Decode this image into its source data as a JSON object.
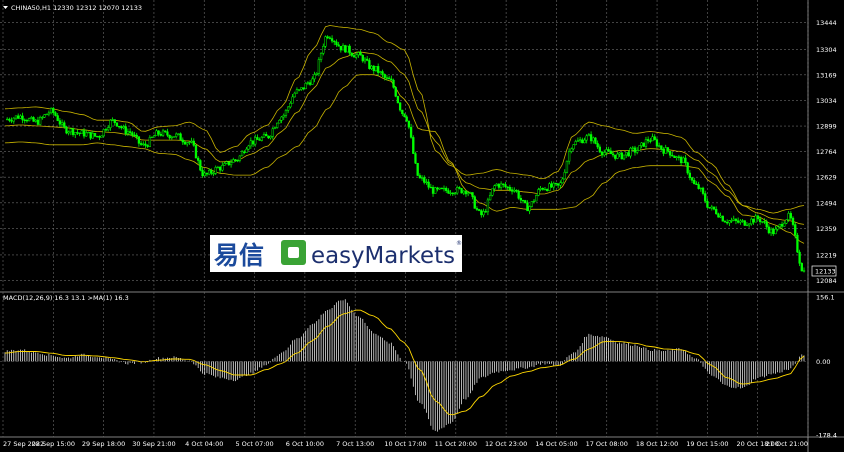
{
  "colors": {
    "background": "#000000",
    "candle": "#00ff00",
    "band": "#c8b400",
    "grid": "#6b6b6b",
    "histogram": "#ffffff",
    "signal": "#ffd800",
    "text": "#ffffff",
    "logo_cn": "#1b4a9c",
    "logo_green": "#3aa335",
    "logo_text": "#1c2f6e"
  },
  "header": {
    "symbol_line": "CHINA50,H1  12330 12312 12070 12133",
    "arrow_icon": "triangle-down-icon"
  },
  "price_last_label": "12133",
  "logo": {
    "chinese": "易信",
    "brand": "easyMarkets",
    "registered": "®"
  },
  "macd_header": "MACD(12,26,9) 16.3 13.1  >MA(1) 16.3",
  "chart_data": [
    {
      "type": "candlestick",
      "title": "CHINA50,H1",
      "indicator": "Bollinger Bands",
      "y_ticks": [
        "13444",
        "13304",
        "13169",
        "13034",
        "12899",
        "12764",
        "12629",
        "12494",
        "12359",
        "12219",
        "12084"
      ],
      "ylim": [
        12050,
        13490
      ],
      "last": 12133,
      "series": [
        {
          "name": "close",
          "values": [
            12935,
            12950,
            12920,
            12975,
            12880,
            12860,
            12845,
            12925,
            12870,
            12795,
            12860,
            12850,
            12815,
            12640,
            12680,
            12720,
            12815,
            12840,
            12950,
            13080,
            13140,
            13380,
            13310,
            13270,
            13200,
            13140,
            12960,
            12620,
            12555,
            12560,
            12560,
            12430,
            12590,
            12570,
            12470,
            12575,
            12580,
            12810,
            12840,
            12760,
            12740,
            12770,
            12830,
            12770,
            12720,
            12580,
            12460,
            12400,
            12390,
            12410,
            12340,
            12420,
            12133
          ]
        },
        {
          "name": "upper",
          "values": [
            12990,
            12995,
            13000,
            12990,
            12975,
            12960,
            12930,
            12930,
            12920,
            12870,
            12895,
            12900,
            12920,
            12880,
            12760,
            12790,
            12860,
            12900,
            13000,
            13150,
            13300,
            13430,
            13420,
            13410,
            13390,
            13340,
            13300,
            13080,
            12770,
            12690,
            12640,
            12650,
            12670,
            12650,
            12640,
            12620,
            12660,
            12850,
            12920,
            12900,
            12880,
            12860,
            12870,
            12860,
            12840,
            12760,
            12700,
            12590,
            12480,
            12460,
            12440,
            12460,
            12480
          ]
        },
        {
          "name": "middle",
          "values": [
            12900,
            12905,
            12900,
            12895,
            12890,
            12880,
            12870,
            12865,
            12855,
            12825,
            12825,
            12825,
            12820,
            12780,
            12710,
            12715,
            12750,
            12790,
            12870,
            12970,
            13090,
            13210,
            13260,
            13290,
            13280,
            13240,
            13170,
            12980,
            12820,
            12700,
            12600,
            12570,
            12560,
            12560,
            12550,
            12540,
            12560,
            12660,
            12720,
            12750,
            12770,
            12770,
            12780,
            12775,
            12765,
            12720,
            12650,
            12560,
            12480,
            12440,
            12410,
            12400,
            12380
          ]
        },
        {
          "name": "lower",
          "values": [
            12810,
            12815,
            12810,
            12800,
            12800,
            12800,
            12810,
            12800,
            12790,
            12780,
            12755,
            12750,
            12720,
            12680,
            12650,
            12640,
            12640,
            12680,
            12740,
            12790,
            12880,
            12990,
            13100,
            13170,
            13170,
            13140,
            13040,
            12880,
            12870,
            12710,
            12560,
            12490,
            12450,
            12470,
            12460,
            12460,
            12460,
            12470,
            12520,
            12600,
            12660,
            12680,
            12690,
            12690,
            12690,
            12680,
            12600,
            12530,
            12430,
            12420,
            12380,
            12340,
            12280
          ]
        }
      ]
    },
    {
      "type": "bar",
      "title": "MACD(12,26,9)",
      "y_ticks": [
        "156.1",
        "0.00",
        "-178.4"
      ],
      "ylim": [
        -178.4,
        156.1
      ],
      "series": [
        {
          "name": "histogram",
          "values": [
            25,
            28,
            22,
            15,
            8,
            16,
            12,
            4,
            -5,
            -2,
            8,
            10,
            2,
            -30,
            -40,
            -45,
            -30,
            -8,
            22,
            55,
            90,
            125,
            150,
            110,
            70,
            45,
            0,
            -100,
            -170,
            -150,
            -90,
            -40,
            -25,
            -20,
            -15,
            -5,
            -10,
            20,
            65,
            60,
            45,
            40,
            28,
            25,
            30,
            5,
            -35,
            -60,
            -65,
            -40,
            -30,
            -20,
            16.3
          ]
        },
        {
          "name": "signal",
          "values": [
            20,
            24,
            24,
            20,
            14,
            15,
            13,
            9,
            4,
            -1,
            3,
            6,
            5,
            -8,
            -22,
            -33,
            -33,
            -20,
            -5,
            20,
            50,
            85,
            115,
            125,
            110,
            80,
            45,
            -20,
            -95,
            -130,
            -120,
            -85,
            -55,
            -35,
            -25,
            -15,
            -10,
            5,
            30,
            48,
            48,
            44,
            36,
            30,
            28,
            18,
            -10,
            -40,
            -55,
            -50,
            -42,
            -32,
            13.1
          ]
        }
      ]
    }
  ],
  "x_ticks": [
    "27 Sep 2022",
    "28 Sep 15:00",
    "29 Sep 18:00",
    "30 Sep 21:00",
    "4 Oct 04:00",
    "5 Oct 07:00",
    "6 Oct 10:00",
    "7 Oct 13:00",
    "10 Oct 17:00",
    "11 Oct 20:00",
    "12 Oct 23:00",
    "14 Oct 05:00",
    "17 Oct 08:00",
    "18 Oct 12:00",
    "19 Oct 15:00",
    "20 Oct 18:00",
    "21 Oct 21:00"
  ]
}
